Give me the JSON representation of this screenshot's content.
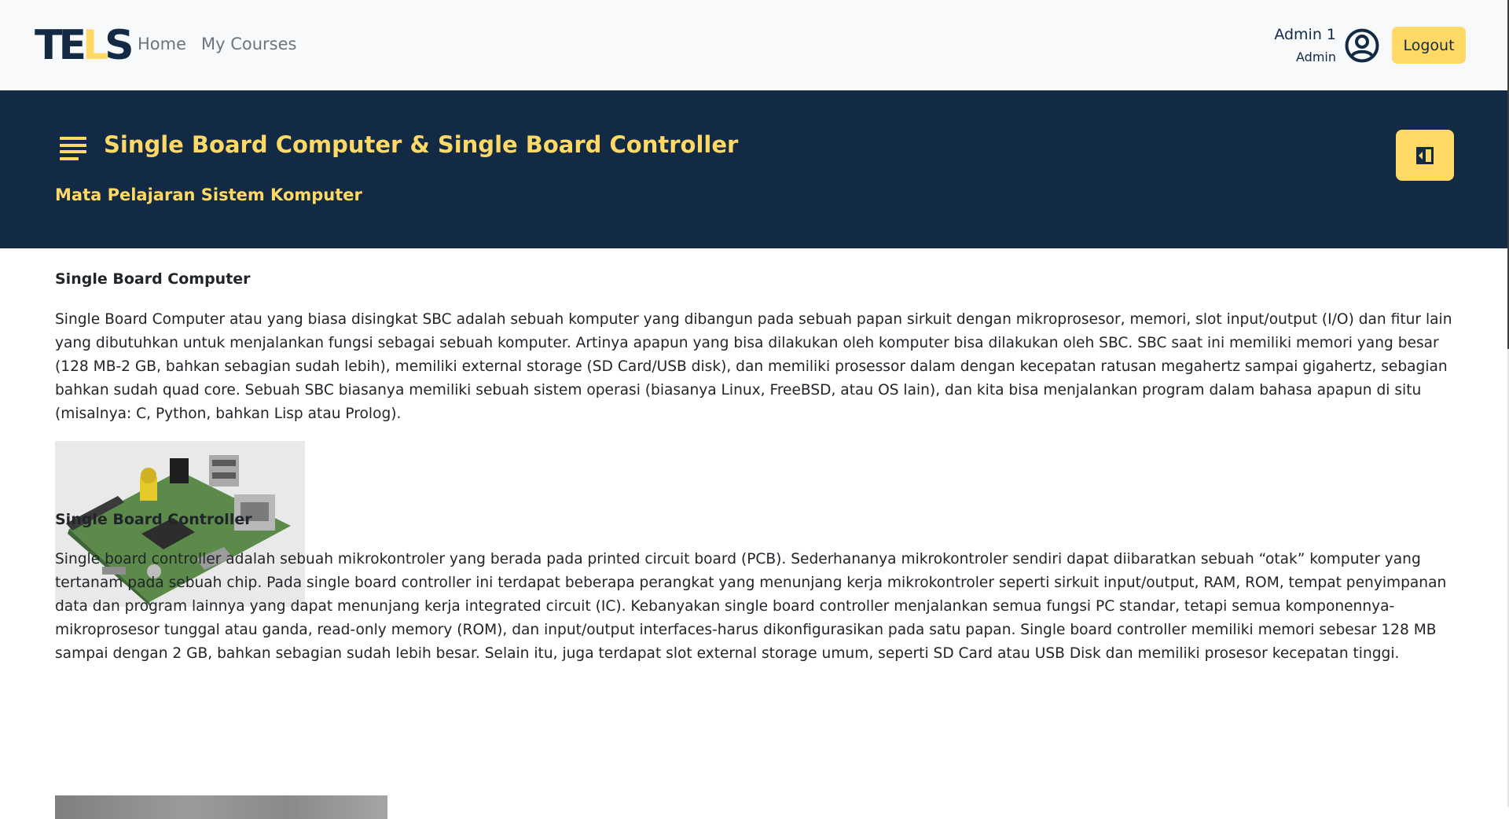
{
  "navbar": {
    "logo": {
      "part1": "TE",
      "part2": "L",
      "part3": "S"
    },
    "links": [
      "Home",
      "My Courses"
    ],
    "user": {
      "name": "Admin 1",
      "role": "Admin"
    },
    "logout_label": "Logout",
    "icons": {
      "avatar": "user-circle-icon"
    }
  },
  "banner": {
    "title": "Single Board Computer & Single Board Controller",
    "subtitle": "Mata Pelajaran Sistem Komputer",
    "icons": {
      "menu": "text-lines-icon",
      "panel_toggle": "sidebar-collapse-icon"
    }
  },
  "content": {
    "sections": [
      {
        "heading": "Single Board Computer",
        "body": "Single Board Computer atau yang biasa disingkat SBC adalah sebuah komputer yang dibangun pada sebuah papan sirkuit dengan mikroprosesor, memori, slot input/output (I/O) dan fitur lain yang dibutuhkan untuk menjalankan fungsi sebagai sebuah komputer. Artinya apapun yang bisa dilakukan oleh komputer bisa dilakukan oleh SBC. SBC saat ini memiliki memori yang besar (128 MB-2 GB, bahkan sebagian sudah lebih), memiliki external storage (SD Card/USB disk), dan memiliki prosessor dalam dengan kecepatan ratusan megahertz sampai gigahertz, sebagian bahkan sudah quad core. Sebuah SBC biasanya memiliki sebuah sistem operasi (biasanya Linux, FreeBSD, atau OS lain), dan kita bisa menjalankan program dalam bahasa apapun di situ (misalnya: C, Python, bahkan Lisp atau Prolog)."
      },
      {
        "heading": "Single Board Controller",
        "body": "Single board controller adalah sebuah mikrokontroler yang berada pada printed circuit board (PCB). Sederhananya mikrokontroler sendiri dapat diibaratkan sebuah “otak” komputer yang tertanam pada sebuah chip. Pada single board controller ini terdapat beberapa perangkat yang menunjang kerja mikrokontroler seperti sirkuit input/output, RAM, ROM, tempat penyimpanan data dan program lainnya yang dapat menunjang kerja integrated circuit (IC). Kebanyakan single board controller menjalankan semua fungsi PC standar, tetapi semua komponennya-mikroprosesor tunggal atau ganda, read-only memory (ROM), dan input/output interfaces-harus dikonfigurasikan pada satu papan. Single board controller memiliki memori sebesar 128 MB sampai dengan 2 GB, bahkan sebagian sudah lebih besar. Selain itu, juga terdapat slot external storage umum, seperti SD Card atau USB Disk dan memiliki prosesor kecepatan tinggi."
      }
    ]
  },
  "colors": {
    "navy": "#132a45",
    "accent_yellow": "#ffd966",
    "navbar_bg": "#f8f9fa",
    "link_gray": "#6c757d",
    "text": "#212529"
  }
}
